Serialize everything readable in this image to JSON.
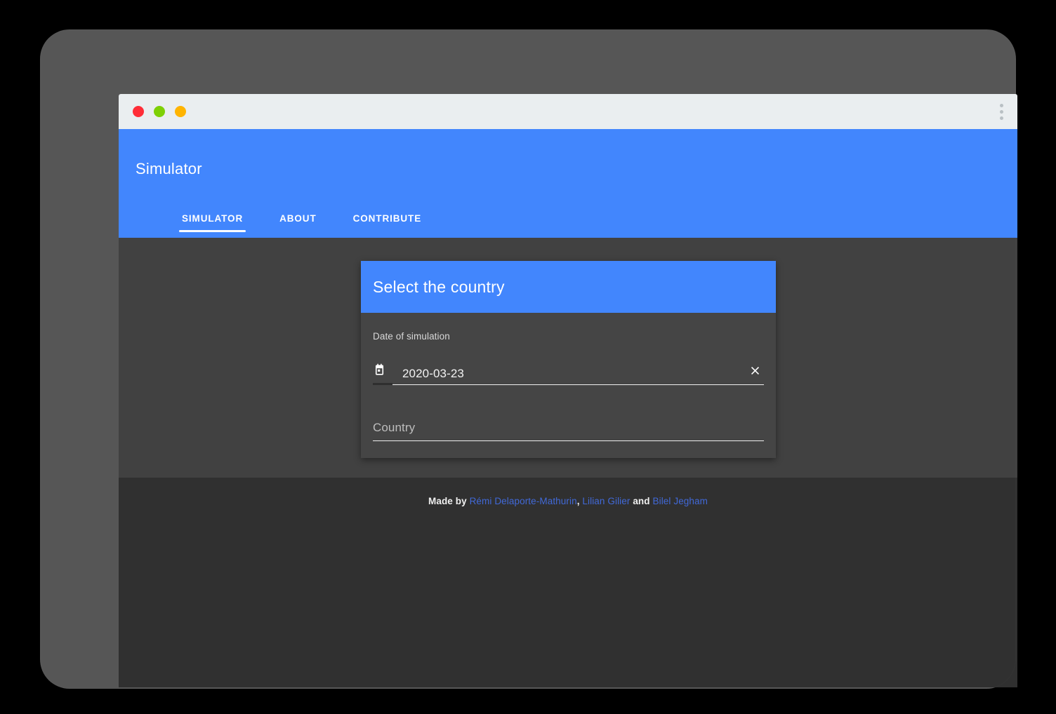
{
  "window": {
    "traffic_lights": [
      {
        "name": "close",
        "color": "#ff2d37"
      },
      {
        "name": "minimize",
        "color": "#7ed005"
      },
      {
        "name": "maximize",
        "color": "#ffb400"
      }
    ],
    "menu_icon": "more-vertical-icon"
  },
  "appbar": {
    "title": "Simulator",
    "accent_color": "#4286fd",
    "tabs": [
      {
        "label": "SIMULATOR",
        "active": true
      },
      {
        "label": "ABOUT",
        "active": false
      },
      {
        "label": "CONTRIBUTE",
        "active": false
      }
    ]
  },
  "card": {
    "title": "Select the country",
    "header_color": "#4286fd",
    "date_field": {
      "label": "Date of simulation",
      "icon": "calendar-icon",
      "value": "2020-03-23",
      "clear_icon": "close-icon"
    },
    "country_field": {
      "placeholder": "Country",
      "value": ""
    }
  },
  "footer": {
    "prefix": "Made by ",
    "authors": [
      {
        "name": "Rémi Delaporte-Mathurin"
      },
      {
        "name": "Lilian Gilier"
      },
      {
        "name": "Bilel Jegham"
      }
    ],
    "separator": ", ",
    "conjunction": " and ",
    "link_color": "#4169d8"
  }
}
